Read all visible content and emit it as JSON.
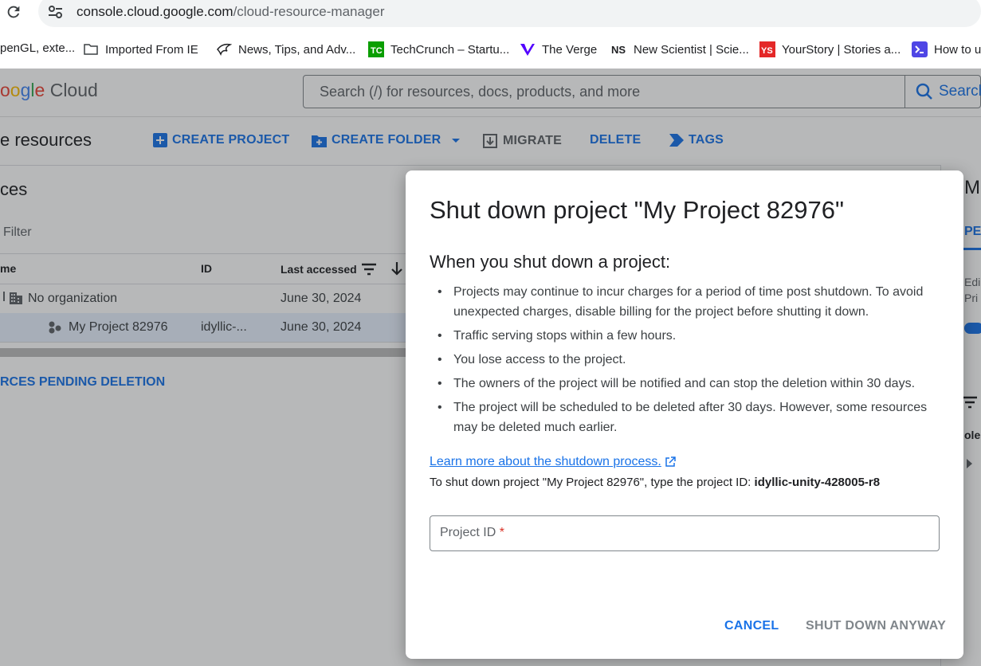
{
  "browser": {
    "url_host": "console.cloud.google.com",
    "url_path": "/cloud-resource-manager",
    "bookmarks": [
      {
        "label": "penGL, exte...",
        "icon": "page-icon"
      },
      {
        "label": "Imported From IE",
        "icon": "folder-icon"
      },
      {
        "label": "News, Tips, and Adv...",
        "icon": "wing-icon"
      },
      {
        "label": "TechCrunch – Startu...",
        "icon": "techcrunch-icon"
      },
      {
        "label": "The Verge",
        "icon": "verge-icon"
      },
      {
        "label": "New Scientist | Scie...",
        "icon": "ns-icon"
      },
      {
        "label": "YourStory | Stories a...",
        "icon": "yourstory-icon"
      },
      {
        "label": "How to u",
        "icon": "terminal-icon"
      }
    ]
  },
  "header": {
    "logo_text": "oogle Cloud",
    "search_placeholder": "Search (/) for resources, docs, products, and more",
    "search_button": "Search"
  },
  "toolbar": {
    "title": "e resources",
    "create_project": "CREATE PROJECT",
    "create_folder": "CREATE FOLDER",
    "migrate": "MIGRATE",
    "delete": "DELETE",
    "tags": "TAGS"
  },
  "resources": {
    "section_title": "ces",
    "filter_placeholder": "Filter",
    "columns": {
      "name": "me",
      "id": "ID",
      "last_accessed": "Last accessed"
    },
    "rows": [
      {
        "name": "No organization",
        "id": "",
        "last_accessed": "June 30, 2024"
      },
      {
        "name": "My Project 82976",
        "id": "idyllic-...",
        "last_accessed": "June 30, 2024"
      }
    ],
    "pending_link": "RCES PENDING DELETION"
  },
  "right_panel": {
    "title": "M",
    "tab": "PE",
    "text1": "Edi",
    "text2": "Pri",
    "text3": "ole"
  },
  "dialog": {
    "title": "Shut down project \"My Project 82976\"",
    "subtitle": "When you shut down a project:",
    "bullets": [
      "Projects may continue to incur charges for a period of time post shutdown. To avoid unexpected charges, disable billing for the project before shutting it down.",
      "Traffic serving stops within a few hours.",
      "You lose access to the project.",
      "The owners of the project will be notified and can stop the deletion within 30 days.",
      "The project will be scheduled to be deleted after 30 days. However, some resources may be deleted much earlier."
    ],
    "learn_more": "Learn more about the shutdown process.",
    "confirm_prefix": "To shut down project \"My Project 82976\", type the project ID: ",
    "project_id": "idyllic-unity-428005-r8",
    "field_label": "Project ID",
    "field_required_mark": "*",
    "field_value": "",
    "cancel": "CANCEL",
    "shutdown": "SHUT DOWN ANYWAY"
  },
  "colors": {
    "accent": "#1a73e8",
    "disabled": "#80868b",
    "required": "#d93025"
  }
}
